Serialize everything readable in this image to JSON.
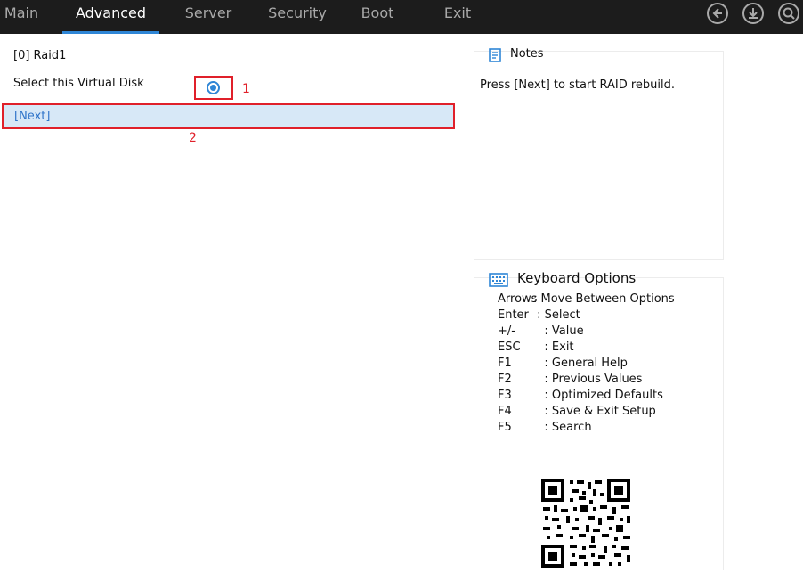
{
  "tabs": [
    {
      "label": "Main"
    },
    {
      "label": "Advanced"
    },
    {
      "label": "Server"
    },
    {
      "label": "Security"
    },
    {
      "label": "Boot"
    },
    {
      "label": "Exit"
    }
  ],
  "active_tab": "Advanced",
  "top_icons": [
    "back-icon",
    "save-download-icon",
    "search-icon"
  ],
  "main": {
    "disk_label": "[0] Raid1",
    "select_label": "Select this Virtual Disk",
    "select_checked": true,
    "next_label": "[Next]",
    "annotation_1": "1",
    "annotation_2": "2"
  },
  "notes": {
    "title": "Notes",
    "text": "Press [Next] to start RAID rebuild."
  },
  "keyboard": {
    "title": "Keyboard Options",
    "items": [
      {
        "key": "Arrows",
        "desc": ": Move Between Options"
      },
      {
        "key": "Enter",
        "desc": " : Select"
      },
      {
        "key": "+/-",
        "desc": "   : Value"
      },
      {
        "key": "ESC",
        "desc": "   : Exit"
      },
      {
        "key": "F1",
        "desc": "   : General Help"
      },
      {
        "key": "F2",
        "desc": "   : Previous Values"
      },
      {
        "key": "F3",
        "desc": "   : Optimized Defaults"
      },
      {
        "key": "F4",
        "desc": "   : Save & Exit Setup"
      },
      {
        "key": "F5",
        "desc": "   : Search"
      }
    ]
  },
  "colors": {
    "accent": "#2f86d6",
    "annotation": "#e0202a",
    "topbar": "#1c1c1c",
    "selected_row": "#d7e8f7"
  }
}
